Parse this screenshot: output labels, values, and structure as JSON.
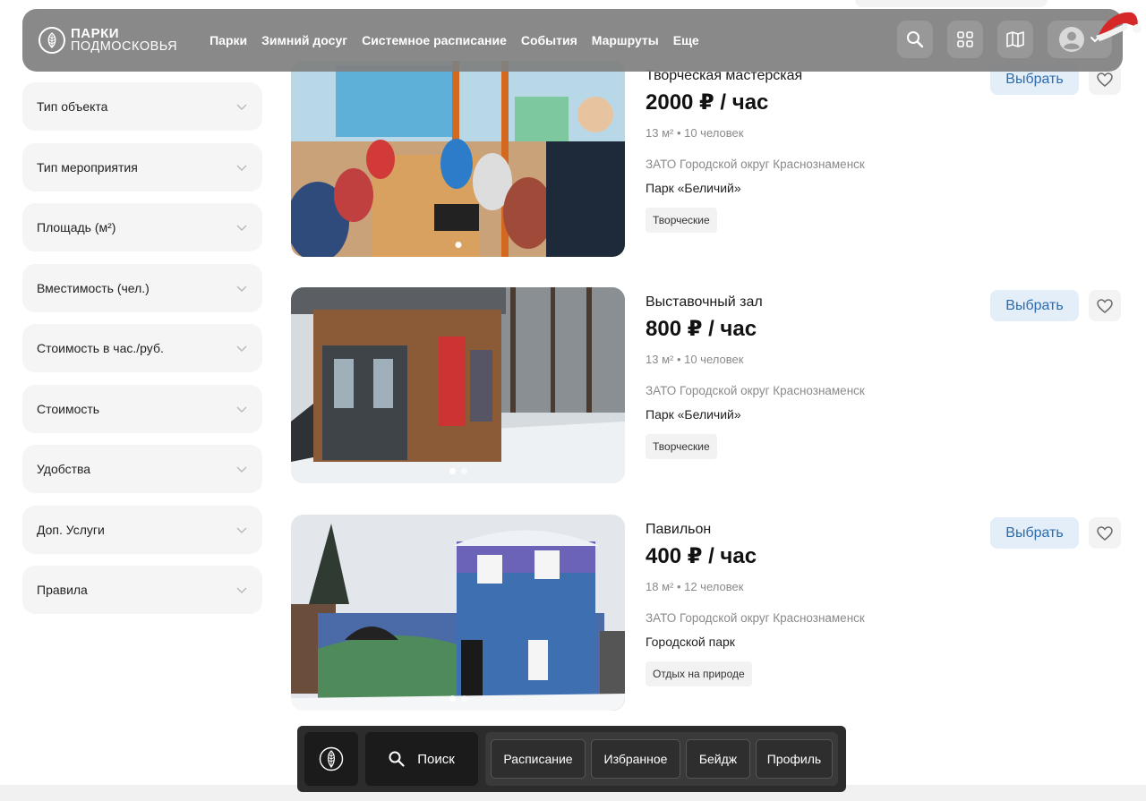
{
  "header": {
    "logo_line1": "ПАРКИ",
    "logo_line2": "ПОДМОСКОВЬЯ",
    "nav": [
      "Парки",
      "Зимний досуг",
      "Системное расписание",
      "События",
      "Маршруты",
      "Еще"
    ],
    "icons": [
      "search-icon",
      "grid-icon",
      "map-icon",
      "user-icon",
      "chevron-down-icon"
    ]
  },
  "filters": [
    "Тип объекта",
    "Тип мероприятия",
    "Площадь (м²)",
    "Вместимость (чел.)",
    "Стоимость в час./руб.",
    "Стоимость",
    "Удобства",
    "Доп. Услуги",
    "Правила"
  ],
  "listings": [
    {
      "kind": "Творческая мастерская",
      "price": "2000 ₽ / час",
      "meta": "13 м² • 10 человек",
      "location": "ЗАТО Городской округ Краснознаменск",
      "park": "Парк «Беличий»",
      "tag": "Творческие",
      "choose_label": "Выбрать"
    },
    {
      "kind": "Выставочный зал",
      "price": "800 ₽ / час",
      "meta": "13 м² • 10 человек",
      "location": "ЗАТО Городской округ Краснознаменск",
      "park": "Парк «Беличий»",
      "tag": "Творческие",
      "choose_label": "Выбрать"
    },
    {
      "kind": "Павильон",
      "price": "400 ₽ / час",
      "meta": "18 м² • 12 человек",
      "location": "ЗАТО Городской округ Краснознаменск",
      "park": "Городской парк",
      "tag": "Отдых на природе",
      "choose_label": "Выбрать"
    }
  ],
  "dock": {
    "search_label": "Поиск",
    "items": [
      "Расписание",
      "Избранное",
      "Бейдж",
      "Профиль"
    ]
  },
  "colors": {
    "header_bg": "#808080",
    "accent_button_bg": "#e4eef8",
    "accent_button_text": "#2b6cb0",
    "dock_bg": "#2c2c2c"
  }
}
